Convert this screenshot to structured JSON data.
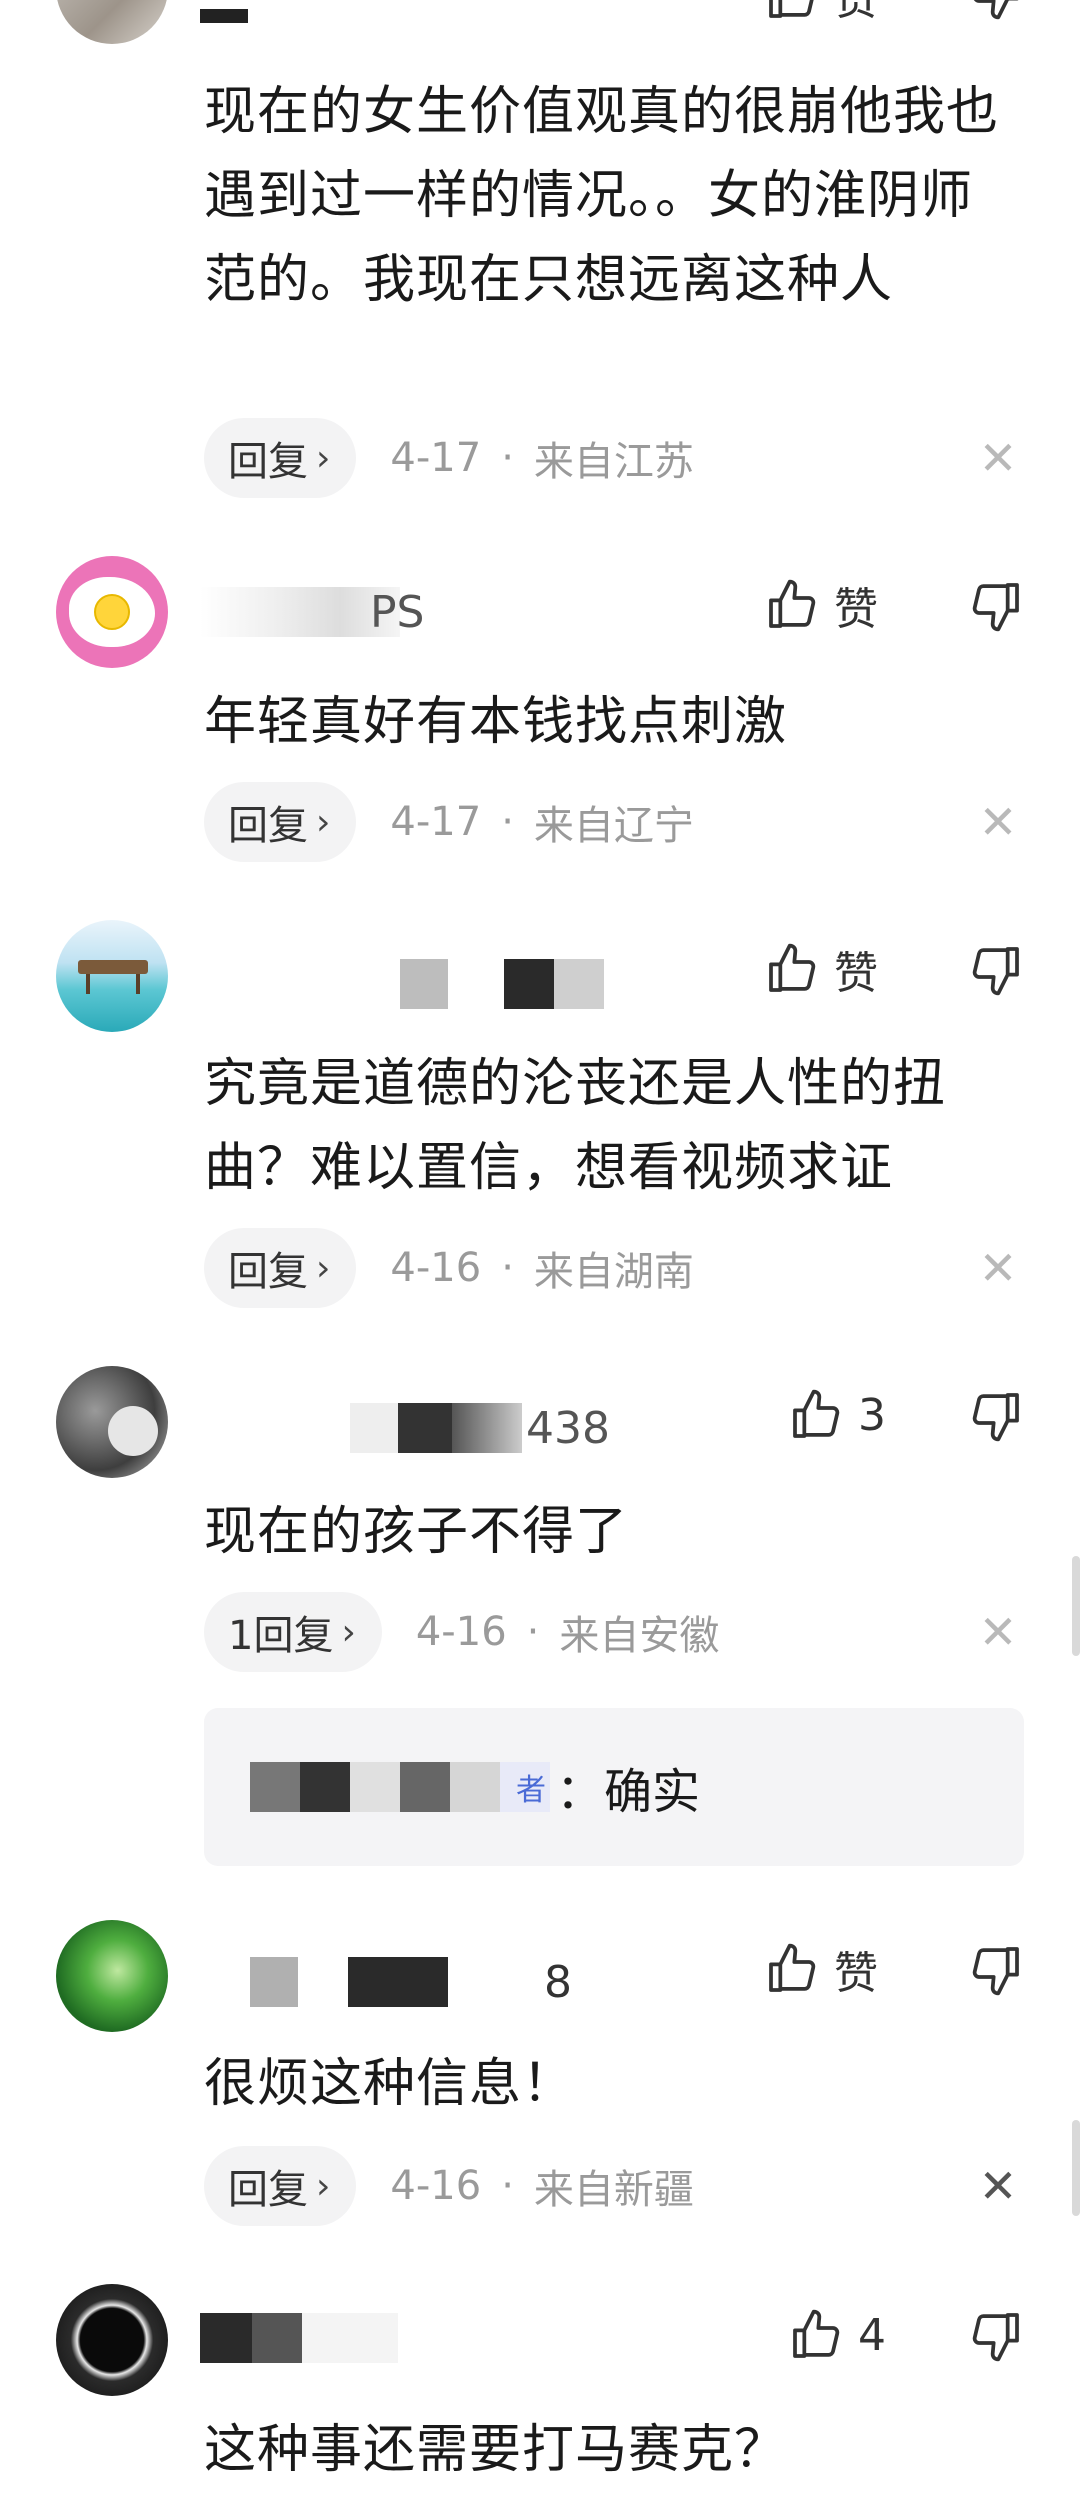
{
  "comments": [
    {
      "text": "现在的女生价值观真的很崩他我也遇到过一样的情况。。女的淮阴师范的。我现在只想远离这种人",
      "reply_label": "回复",
      "date": "4-17",
      "location": "来自江苏",
      "like_label": "赞"
    },
    {
      "username": "PS",
      "like_label": "赞",
      "text": "年轻真好有本钱找点刺激",
      "reply_label": "回复",
      "date": "4-17",
      "location": "来自辽宁"
    },
    {
      "like_label": "赞",
      "text": "究竟是道德的沦丧还是人性的扭曲？难以置信，想看视频求证",
      "reply_label": "回复",
      "date": "4-16",
      "location": "来自湖南"
    },
    {
      "username": "438",
      "like_count": "3",
      "text": "现在的孩子不得了",
      "reply_label": "1回复",
      "date": "4-16",
      "location": "来自安徽",
      "sub_reply": {
        "name_fragment": "者",
        "text": "：确实"
      }
    },
    {
      "username": "8",
      "like_label": "赞",
      "text": "很烦这种信息！",
      "reply_label": "回复",
      "date": "4-16",
      "location": "来自新疆"
    },
    {
      "like_count": "4",
      "text": "这种事还需要打马赛克？"
    }
  ],
  "separator": "·",
  "colors": {
    "meta_text": "#9a9a9a",
    "pill_bg": "#f3f3f4",
    "subreply_bg": "#f4f4f6"
  }
}
